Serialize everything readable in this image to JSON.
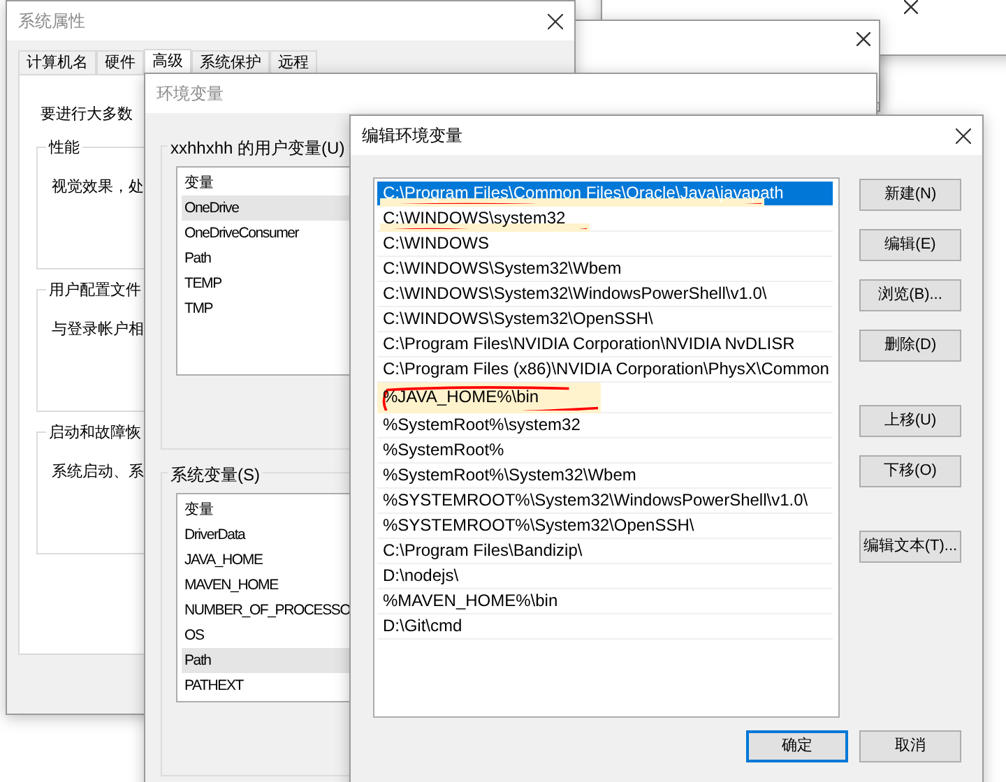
{
  "system_properties": {
    "title": "系统属性",
    "tabs": [
      {
        "label": "计算机名",
        "selected": false
      },
      {
        "label": "硬件",
        "selected": false
      },
      {
        "label": "高级",
        "selected": true
      },
      {
        "label": "系统保护",
        "selected": false
      },
      {
        "label": "远程",
        "selected": false
      }
    ],
    "intro": "要进行大多数",
    "groups": [
      {
        "title": "性能",
        "text": "视觉效果，处"
      },
      {
        "title": "用户配置文件",
        "text": "与登录帐户相"
      },
      {
        "title": "启动和故障恢",
        "text": "系统启动、系"
      }
    ]
  },
  "environment_variables": {
    "title": "环境变量",
    "user_group": {
      "title": "xxhhxhh 的用户变量(U)",
      "header": "变量",
      "rows": [
        {
          "name": "OneDrive",
          "selected": true
        },
        {
          "name": "OneDriveConsumer",
          "selected": false
        },
        {
          "name": "Path",
          "selected": false
        },
        {
          "name": "TEMP",
          "selected": false
        },
        {
          "name": "TMP",
          "selected": false
        }
      ]
    },
    "system_group": {
      "title": "系统变量(S)",
      "header": "变量",
      "rows": [
        {
          "name": "DriverData",
          "selected": false
        },
        {
          "name": "JAVA_HOME",
          "selected": false
        },
        {
          "name": "MAVEN_HOME",
          "selected": false
        },
        {
          "name": "NUMBER_OF_PROCESSO",
          "selected": false
        },
        {
          "name": "OS",
          "selected": false
        },
        {
          "name": "Path",
          "selected": true
        },
        {
          "name": "PATHEXT",
          "selected": false
        }
      ]
    }
  },
  "edit_dialog": {
    "title": "编辑环境变量",
    "entries": [
      {
        "text": "C:\\Program Files\\Common Files\\Oracle\\Java\\javapath",
        "selected": true,
        "redacted": true,
        "circled": false
      },
      {
        "text": "C:\\WINDOWS\\system32",
        "selected": false,
        "redacted": true,
        "circled": false
      },
      {
        "text": "C:\\WINDOWS",
        "selected": false,
        "redacted": false,
        "circled": false
      },
      {
        "text": "C:\\WINDOWS\\System32\\Wbem",
        "selected": false,
        "redacted": false,
        "circled": false
      },
      {
        "text": "C:\\WINDOWS\\System32\\WindowsPowerShell\\v1.0\\",
        "selected": false,
        "redacted": false,
        "circled": false
      },
      {
        "text": "C:\\WINDOWS\\System32\\OpenSSH\\",
        "selected": false,
        "redacted": false,
        "circled": false
      },
      {
        "text": "C:\\Program Files\\NVIDIA Corporation\\NVIDIA NvDLISR",
        "selected": false,
        "redacted": false,
        "circled": false
      },
      {
        "text": "C:\\Program Files (x86)\\NVIDIA Corporation\\PhysX\\Common",
        "selected": false,
        "redacted": false,
        "circled": false
      },
      {
        "text": "%JAVA_HOME%\\bin",
        "selected": false,
        "redacted": false,
        "circled": true
      },
      {
        "text": "%SystemRoot%\\system32",
        "selected": false,
        "redacted": false,
        "circled": false
      },
      {
        "text": "%SystemRoot%",
        "selected": false,
        "redacted": false,
        "circled": false
      },
      {
        "text": "%SystemRoot%\\System32\\Wbem",
        "selected": false,
        "redacted": false,
        "circled": false
      },
      {
        "text": "%SYSTEMROOT%\\System32\\WindowsPowerShell\\v1.0\\",
        "selected": false,
        "redacted": false,
        "circled": false
      },
      {
        "text": "%SYSTEMROOT%\\System32\\OpenSSH\\",
        "selected": false,
        "redacted": false,
        "circled": false
      },
      {
        "text": "C:\\Program Files\\Bandizip\\",
        "selected": false,
        "redacted": false,
        "circled": false
      },
      {
        "text": "D:\\nodejs\\",
        "selected": false,
        "redacted": false,
        "circled": false
      },
      {
        "text": "%MAVEN_HOME%\\bin",
        "selected": false,
        "redacted": false,
        "circled": false
      },
      {
        "text": "D:\\Git\\cmd",
        "selected": false,
        "redacted": false,
        "circled": false
      }
    ],
    "side_buttons": [
      [
        "新建(N)",
        "编辑(E)",
        "浏览(B)...",
        "删除(D)"
      ],
      [
        "上移(U)",
        "下移(O)"
      ],
      [
        "编辑文本(T)..."
      ]
    ],
    "ok_button": "确定",
    "cancel_button": "取消"
  }
}
